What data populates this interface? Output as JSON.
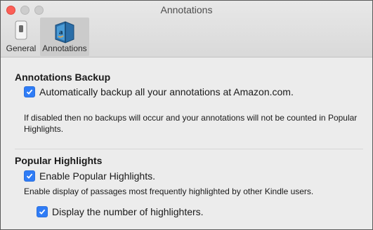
{
  "window": {
    "title": "Annotations"
  },
  "toolbar": {
    "tabs": [
      {
        "label": "General",
        "icon": "switch-icon",
        "selected": false
      },
      {
        "label": "Annotations",
        "icon": "kindle-book-icon",
        "selected": true
      }
    ]
  },
  "backup": {
    "heading": "Annotations Backup",
    "checkbox_label": "Automatically backup all your annotations at Amazon.com.",
    "checked": true,
    "description": "If disabled then no backups will occur and your annotations will not be counted in Popular Highlights."
  },
  "popular": {
    "heading": "Popular Highlights",
    "enable_label": "Enable Popular Highlights.",
    "enable_checked": true,
    "description": "Enable display of passages most frequently highlighted by other Kindle users.",
    "count_label": "Display the number of highlighters.",
    "count_checked": true
  },
  "colors": {
    "checkbox_accent": "#2f7cf6",
    "close_button": "#fc5f57",
    "selected_tab_bg": "#cbcbcb"
  }
}
